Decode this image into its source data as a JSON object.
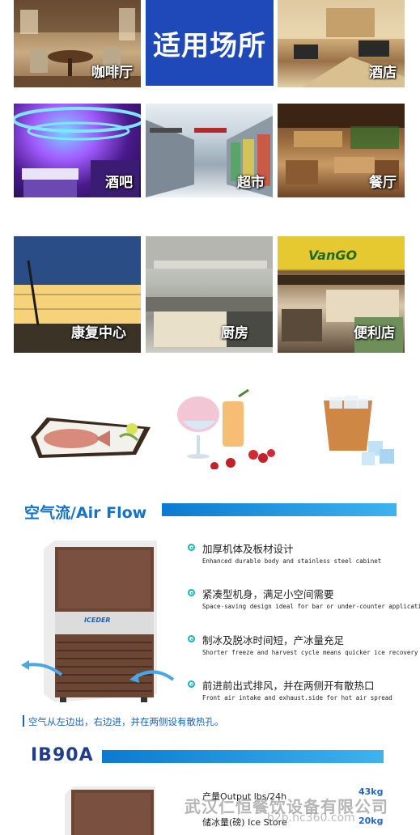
{
  "venues": {
    "title": "适用场所",
    "cafe": "咖啡厅",
    "hotel": "酒店",
    "bar": "酒吧",
    "supermarket": "超市",
    "restaurant": "餐厅",
    "rehab": "康复中心",
    "kitchen": "厨房",
    "convenience": "便利店",
    "store_sign": "VanGO"
  },
  "airflow": {
    "title": "空气流/Air Flow",
    "features": [
      {
        "zh": "加厚机体及板材设计",
        "en": "Enhanced durable body and stainless steel cabinet"
      },
      {
        "zh": "紧凑型机身，满足小空间需要",
        "en": "Space-saving design ideal for bar or under-counter application"
      },
      {
        "zh": "制冰及脱冰时间短，产冰量充足",
        "en": "Shorter freeze and harvest cycle means quicker ice recovery"
      },
      {
        "zh": "前进前出式排风，并在两侧开有散热口",
        "en": "Front air intake and exhaust.side for hot air spread"
      }
    ],
    "note": "空气从左边出，右边进，并在两侧设有散热孔。",
    "brand": "ICEDER"
  },
  "model": {
    "name": "IB90A",
    "specs": [
      {
        "label": "产量Output lbs/24h",
        "value": "43kg"
      },
      {
        "label": "储冰量(磅) Ice Store",
        "value": "20kg"
      }
    ]
  },
  "watermark": {
    "company": "武汉仁恒餐饮设备有限公司",
    "site": "b2b.hc360.com"
  },
  "colors": {
    "title_bg": "#1f49b8",
    "accent_blue": "#1373c8",
    "bullet_teal": "#19b3b8",
    "machine_brown": "#6b4634"
  }
}
